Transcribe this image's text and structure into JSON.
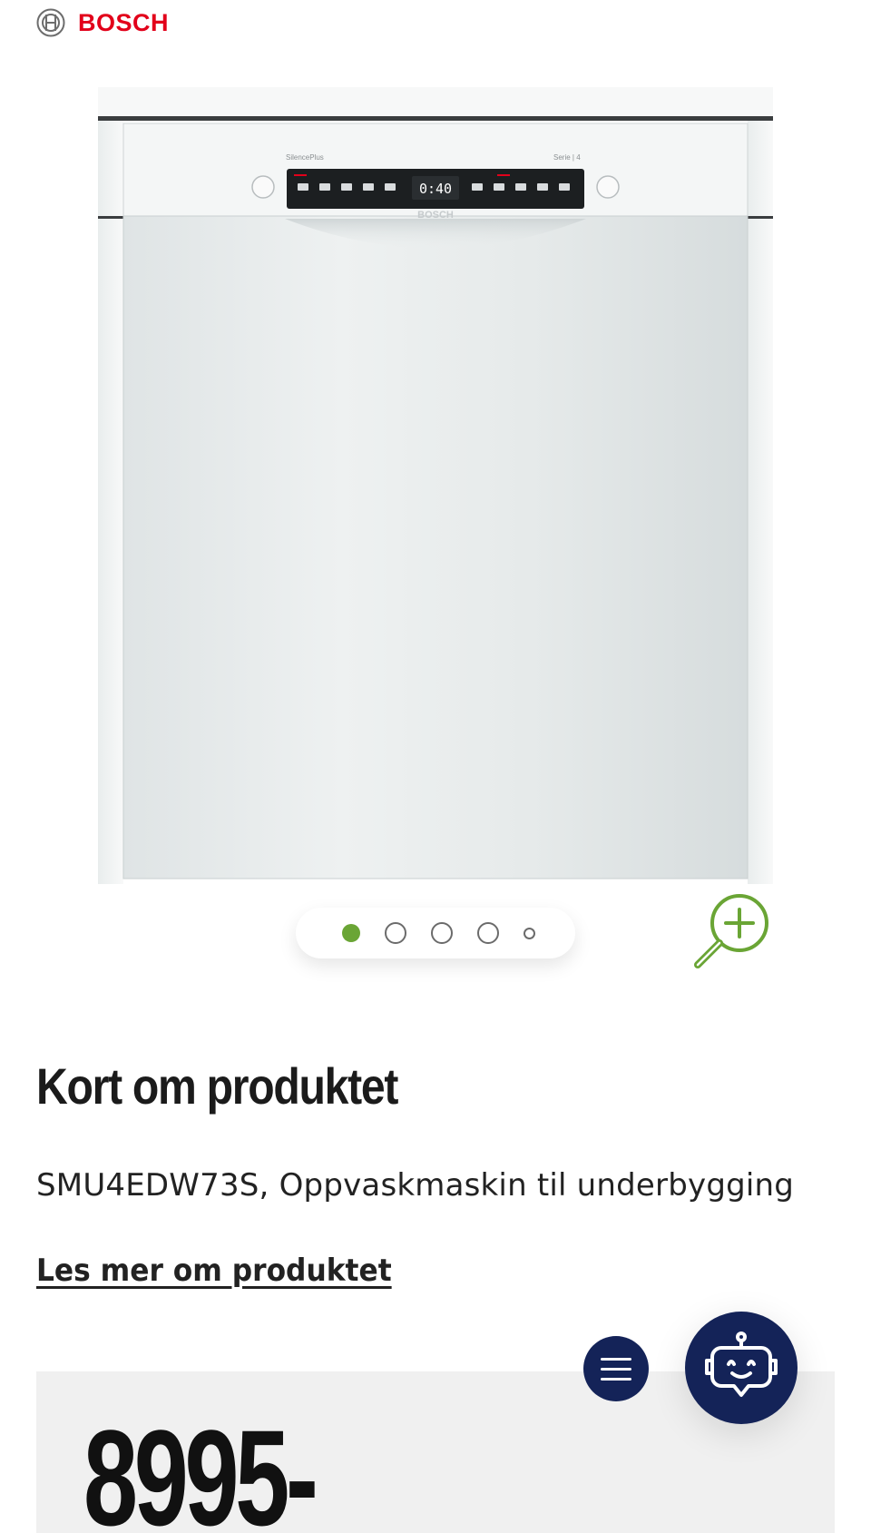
{
  "brand": {
    "name": "BOSCH",
    "color": "#e2001a",
    "icon": "bosch-armature-icon"
  },
  "product_image": {
    "panel_label": "SilencePlus",
    "series_label": "Serie | 4",
    "display_time": "0:40",
    "alt_brand": "BOSCH"
  },
  "carousel": {
    "count": 5,
    "active_index": 0,
    "active_color": "#6aa535"
  },
  "zoom": {
    "icon": "zoom-in-icon",
    "color": "#6aa535"
  },
  "section": {
    "title": "Kort om produktet",
    "description": "SMU4EDW73S, Oppvaskmaskin til underbygging",
    "read_more": "Les mer om produktet"
  },
  "price": {
    "value": "8995-"
  },
  "fabs": {
    "menu_icon": "hamburger-menu-icon",
    "assistant_icon": "chatbot-robot-icon",
    "color": "#142358"
  }
}
